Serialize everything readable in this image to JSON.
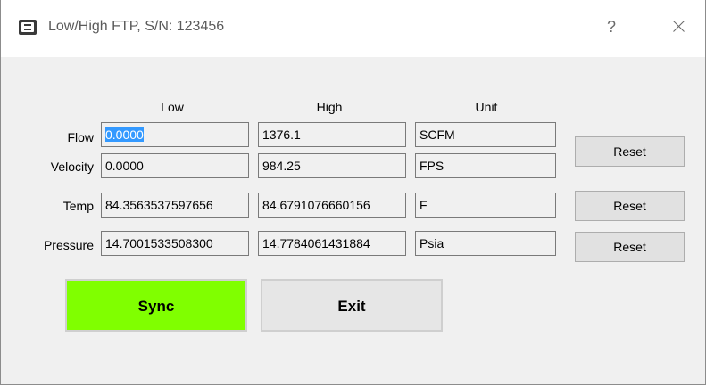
{
  "window": {
    "title": "Low/High FTP, S/N: 123456",
    "help_label": "?"
  },
  "columns": {
    "low": "Low",
    "high": "High",
    "unit": "Unit"
  },
  "rows": [
    {
      "label": "Flow",
      "low": "0.0000",
      "high": "1376.1",
      "unit": "SCFM"
    },
    {
      "label": "Velocity",
      "low": "0.0000",
      "high": "984.25",
      "unit": "FPS"
    },
    {
      "label": "Temp",
      "low": "84.3563537597656",
      "high": "84.6791076660156",
      "unit": "F"
    },
    {
      "label": "Pressure",
      "low": "14.7001533508300",
      "high": "14.7784061431884",
      "unit": "Psia"
    }
  ],
  "buttons": {
    "reset_flow": "Reset",
    "reset_temp": "Reset",
    "reset_pressure": "Reset",
    "sync": "Sync",
    "exit": "Exit"
  }
}
